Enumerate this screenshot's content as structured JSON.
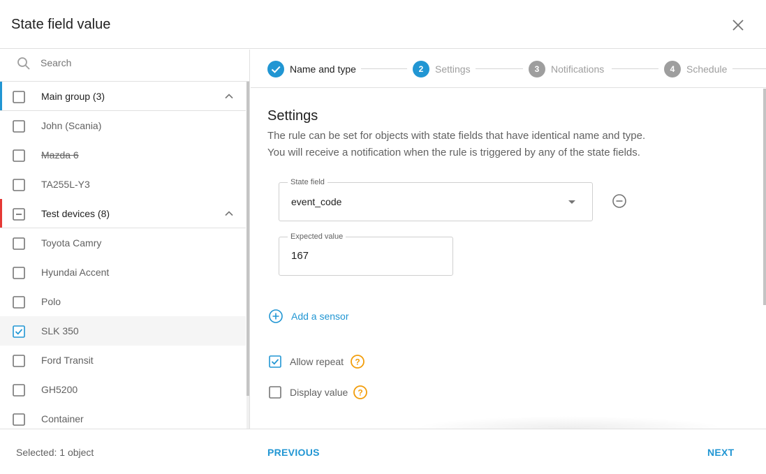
{
  "dialog": {
    "title": "State field value"
  },
  "search": {
    "placeholder": "Search"
  },
  "colors": {
    "accent": "#2196d3",
    "group_main": "#2196d3",
    "group_test": "#e53935",
    "help": "#f29d0b",
    "step_inactive": "#9e9e9e"
  },
  "objects": [
    {
      "label": "Main group (3)",
      "type": "group",
      "checkbox": "unchecked",
      "accent": "#2196d3",
      "strike": false,
      "expanded": true
    },
    {
      "label": "John (Scania)",
      "type": "item",
      "checkbox": "unchecked",
      "strike": false
    },
    {
      "label": "Mazda 6",
      "type": "item",
      "checkbox": "unchecked",
      "strike": true
    },
    {
      "label": "TA255L-Y3",
      "type": "item",
      "checkbox": "unchecked",
      "strike": false
    },
    {
      "label": "Test devices (8)",
      "type": "group",
      "checkbox": "indeterminate",
      "accent": "#e53935",
      "strike": false,
      "expanded": true
    },
    {
      "label": "Toyota Camry",
      "type": "item",
      "checkbox": "unchecked",
      "strike": false
    },
    {
      "label": "Hyundai Accent",
      "type": "item",
      "checkbox": "unchecked",
      "strike": false
    },
    {
      "label": "Polo",
      "type": "item",
      "checkbox": "unchecked",
      "strike": false
    },
    {
      "label": "SLK 350",
      "type": "item",
      "checkbox": "checked",
      "strike": false,
      "selected": true
    },
    {
      "label": "Ford Transit",
      "type": "item",
      "checkbox": "unchecked",
      "strike": false
    },
    {
      "label": "GH5200",
      "type": "item",
      "checkbox": "unchecked",
      "strike": false
    },
    {
      "label": "Container",
      "type": "item",
      "checkbox": "unchecked",
      "strike": false
    }
  ],
  "stepper": {
    "steps": [
      {
        "number": "1",
        "label": "Name and type",
        "state": "done"
      },
      {
        "number": "2",
        "label": "Settings",
        "state": "active"
      },
      {
        "number": "3",
        "label": "Notifications",
        "state": "pending"
      },
      {
        "number": "4",
        "label": "Schedule",
        "state": "pending"
      }
    ]
  },
  "settings": {
    "title": "Settings",
    "description_line1": "The rule can be set for objects with state fields that have identical name and type.",
    "description_line2": "You will receive a notification when the rule is triggered by any of the state fields.",
    "state_field": {
      "label": "State field",
      "value": "event_code"
    },
    "expected_value": {
      "label": "Expected value",
      "value": "167"
    },
    "add_sensor_label": "Add a sensor",
    "allow_repeat": {
      "label": "Allow repeat",
      "checked": true
    },
    "display_value": {
      "label": "Display value",
      "checked": false
    }
  },
  "footer": {
    "selected_text": "Selected: 1 object",
    "previous_label": "PREVIOUS",
    "next_label": "NEXT"
  }
}
